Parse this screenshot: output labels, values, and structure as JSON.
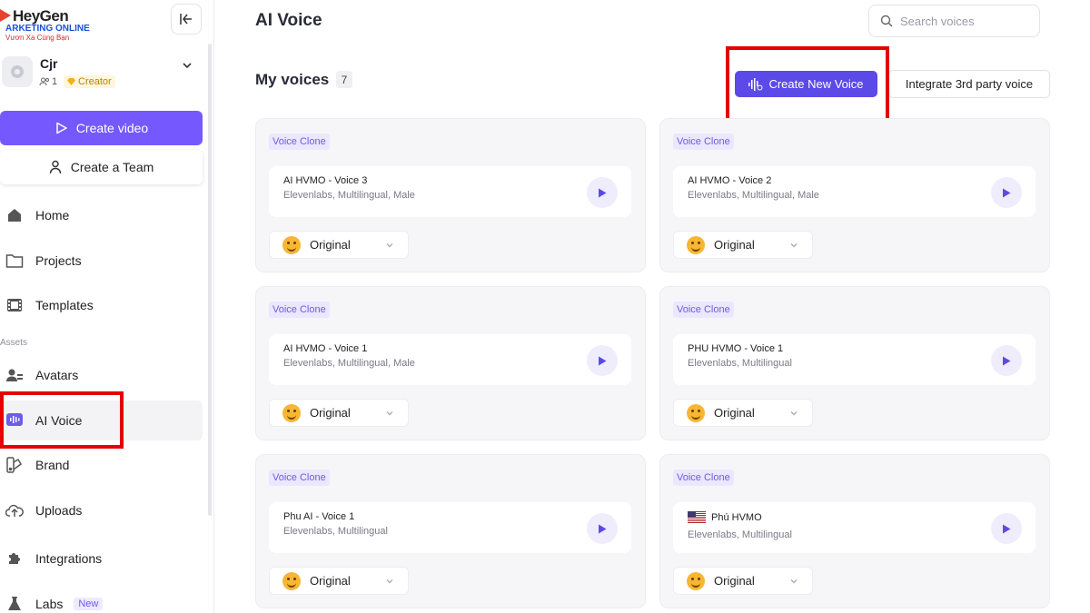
{
  "brand": {
    "logo_text": "HeyGen",
    "watermark_line1": "ARKETING ONLINE",
    "watermark_line2": "Vươn Xa Cùng Bạn"
  },
  "workspace": {
    "name": "Cjr",
    "members": "1",
    "plan": "Creator"
  },
  "sidebar": {
    "create_video": "Create video",
    "create_team": "Create a Team",
    "assets_label": "Assets",
    "items": [
      {
        "label": "Home",
        "icon": "home-icon"
      },
      {
        "label": "Projects",
        "icon": "folder-icon"
      },
      {
        "label": "Templates",
        "icon": "film-icon"
      },
      {
        "label": "Avatars",
        "icon": "avatars-icon"
      },
      {
        "label": "AI Voice",
        "icon": "voice-icon",
        "active": true
      },
      {
        "label": "Brand",
        "icon": "brand-icon"
      },
      {
        "label": "Uploads",
        "icon": "upload-icon"
      },
      {
        "label": "Integrations",
        "icon": "puzzle-icon"
      },
      {
        "label": "Labs",
        "icon": "flask-icon",
        "badge": "New"
      }
    ]
  },
  "header": {
    "title": "AI Voice",
    "search_placeholder": "Search voices"
  },
  "main": {
    "section_title": "My voices",
    "voice_count": "7",
    "create_new_voice": "Create New Voice",
    "integrate_voice": "Integrate 3rd party voice",
    "cards": [
      {
        "tag": "Voice Clone",
        "name": "AI HVMO - Voice 3",
        "desc": "Elevenlabs, Multilingual, Male",
        "style": "Original"
      },
      {
        "tag": "Voice Clone",
        "name": "AI HVMO - Voice 2",
        "desc": "Elevenlabs, Multilingual, Male",
        "style": "Original"
      },
      {
        "tag": "Voice Clone",
        "name": "AI HVMO - Voice 1",
        "desc": "Elevenlabs, Multilingual, Male",
        "style": "Original"
      },
      {
        "tag": "Voice Clone",
        "name": "PHU HVMO - Voice 1",
        "desc": "Elevenlabs, Multilingual",
        "style": "Original"
      },
      {
        "tag": "Voice Clone",
        "name": "Phu AI - Voice 1",
        "desc": "Elevenlabs, Multilingual",
        "style": "Original"
      },
      {
        "tag": "Voice Clone",
        "name": "Phú HVMO",
        "desc": "Elevenlabs, Multilingual",
        "style": "Original",
        "flag": "us-flag-icon"
      }
    ]
  },
  "colors": {
    "accent": "#7559ff",
    "primary_button": "#5b4ae8",
    "highlight_box": "#e50000"
  }
}
